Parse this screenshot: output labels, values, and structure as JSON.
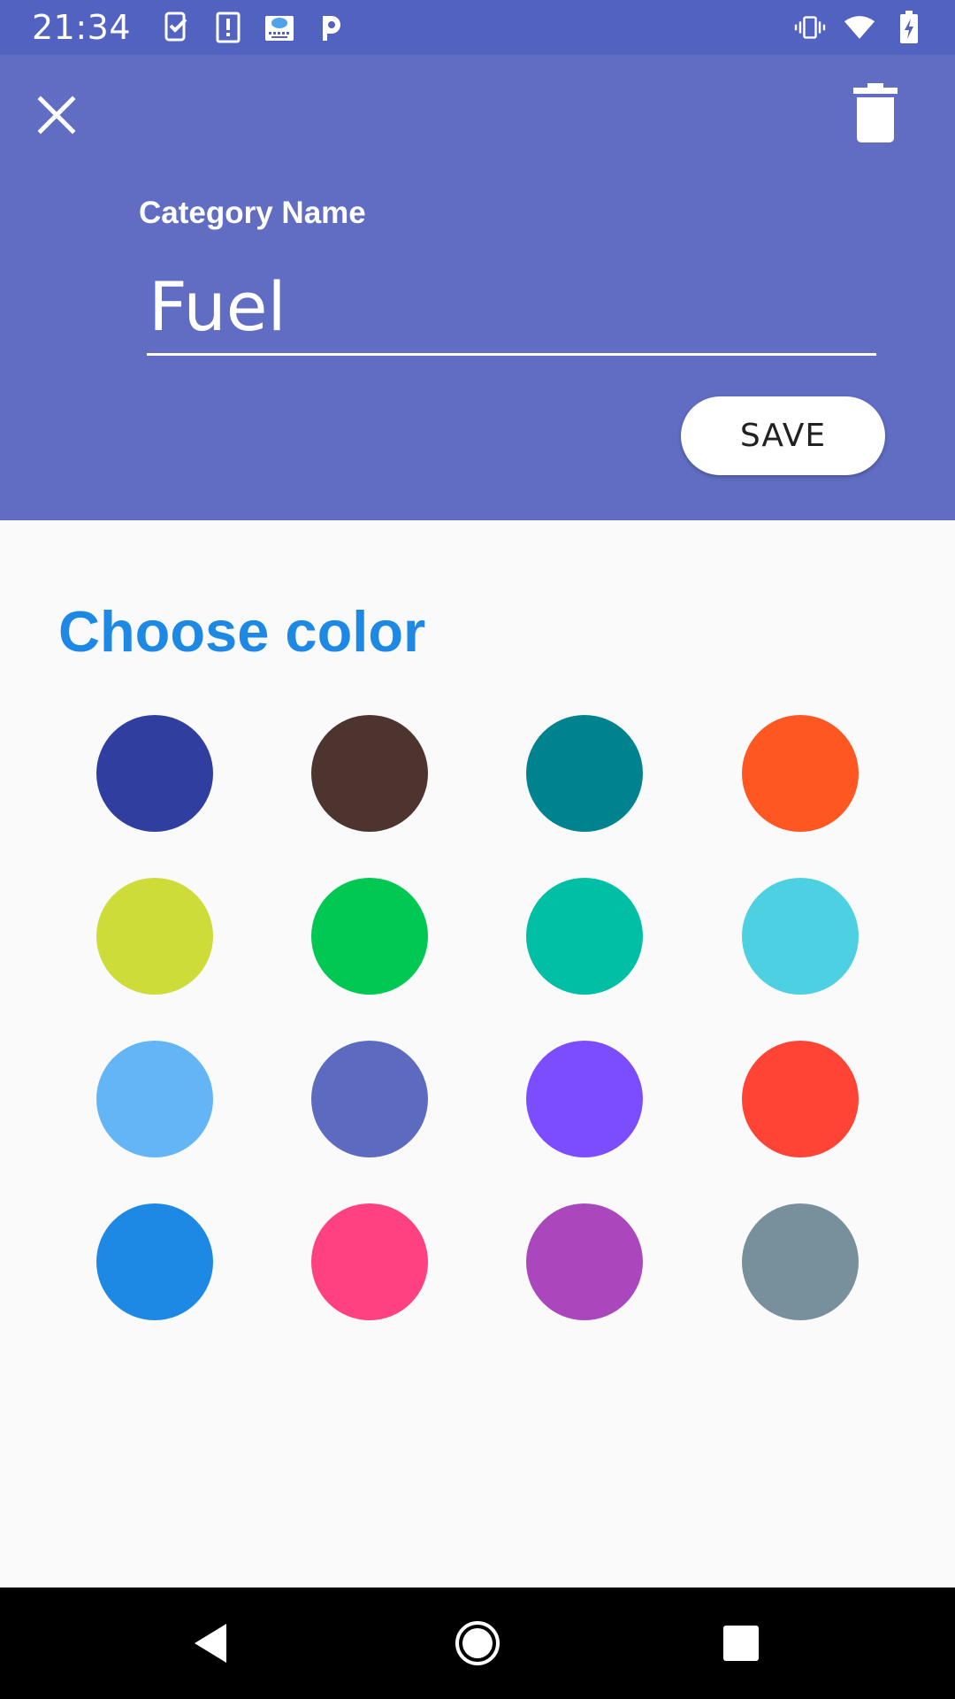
{
  "status_bar": {
    "time": "21:34",
    "left_icons": [
      "task-check-icon",
      "alert-card-icon",
      "cloud-keyboard-icon",
      "parking-p-icon"
    ],
    "right_icons": [
      "vibrate-icon",
      "wifi-icon",
      "battery-charging-icon"
    ]
  },
  "header": {
    "background": "#606dc2",
    "close_icon": "close-icon",
    "delete_icon": "trash-icon",
    "field_label": "Category Name",
    "name_value": "Fuel",
    "save_label": "SAVE"
  },
  "main": {
    "section_title": "Choose color",
    "title_color": "#1e88e5",
    "colors": [
      "#303f9f",
      "#4e342e",
      "#00838f",
      "#ff5722",
      "#cddc39",
      "#00c853",
      "#00bfa5",
      "#4dd0e1",
      "#64b5f6",
      "#5c6bc0",
      "#7c4dff",
      "#ff4436",
      "#1e88e5",
      "#ff4081",
      "#ab47bc",
      "#78909c"
    ]
  },
  "nav_bar": {
    "back_icon": "back-triangle-icon",
    "home_icon": "home-circle-icon",
    "recents_icon": "recents-square-icon"
  }
}
